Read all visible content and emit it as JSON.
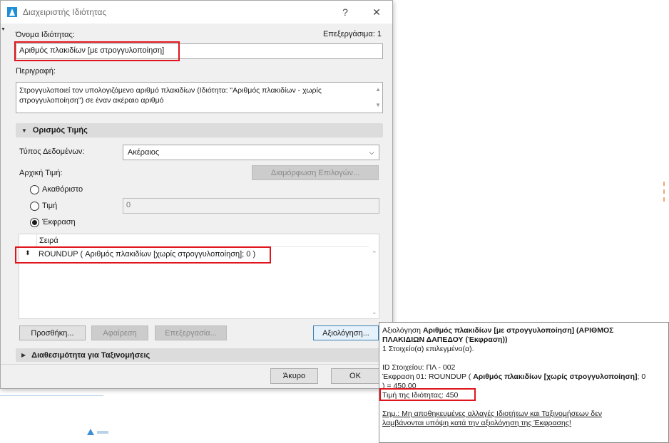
{
  "window": {
    "title": "Διαχειριστής Ιδιότητας",
    "help_glyph": "?",
    "close_glyph": "✕"
  },
  "property": {
    "name_label": "Όνομα Ιδιότητας:",
    "edit_status": "Επεξεργάσιμα: 1",
    "name_value": "Αριθμός πλακιδίων [με στρογγυλοποίηση]",
    "description_label": "Περιγραφή:",
    "description_value": "Στρογγυλοποιεί τον υπολογιζόμενο αριθμό πλακιδίων (Ιδιότητα: \"Αριθμός πλακιδίων - χωρίς στρογγυλοποίηση\") σε έναν ακέραιο αριθμό"
  },
  "value_definition": {
    "section_title": "Ορισμός Τιμής",
    "data_type_label": "Τύπος Δεδομένων:",
    "data_type_value": "Ακέραιος",
    "default_value_label": "Αρχική Τιμή:",
    "configure_options_button": "Διαμόρφωση Επιλογών...",
    "radio_undefined": "Ακαθόριστο",
    "radio_value": "Τιμή",
    "value_field": "0",
    "radio_expression": "Έκφραση",
    "list_header": "Σειρά",
    "expression_row": "ROUNDUP ( Αριθμός πλακιδίων [χωρίς στρογγυλοποίηση]; 0 )",
    "add_button": "Προσθήκη...",
    "remove_button": "Αφαίρεση",
    "edit_button": "Επεξεργασία...",
    "evaluate_button": "Αξιολόγηση..."
  },
  "availability": {
    "section_title": "Διαθεσιμότητα για Ταξινομήσεις"
  },
  "footer": {
    "cancel_button": "Άκυρο",
    "ok_button": "OK"
  },
  "tooltip": {
    "line1_prefix": "Αξιολόγηση ",
    "line1_bold": "Αριθμός πλακιδίων [με στρογγυλοποίηση] (ΑΡΙΘΜΟΣ",
    "line2_bold": "ΠΛΑΚΙΔΙΩΝ ΔΑΠΕΔΟΥ (Έκφραση))",
    "line3": "1 Στοιχείο(α) επιλεγμένο(α).",
    "line4": "ID Στοιχείου: ΠΛ - 002",
    "line5_prefix": "Έκφραση 01: ROUNDUP ( ",
    "line5_bold": "Αριθμός πλακιδίων [χωρίς στρογγυλοποίηση]",
    "line5_suffix": "; 0",
    "line6": ") = 450,00",
    "line7": "Τιμή της Ιδιότητας: 450",
    "note_line1": "Σημ.: Μη αποθηκευμένες αλλαγές Ιδιοτήτων και Ταξινομήσεων δεν",
    "note_line2": "λαμβάνονται υπόψη κατά την αξιολόγηση της Έκφρασης!"
  },
  "colors": {
    "highlight": "#e0141c",
    "accent": "#3c7fb1"
  }
}
